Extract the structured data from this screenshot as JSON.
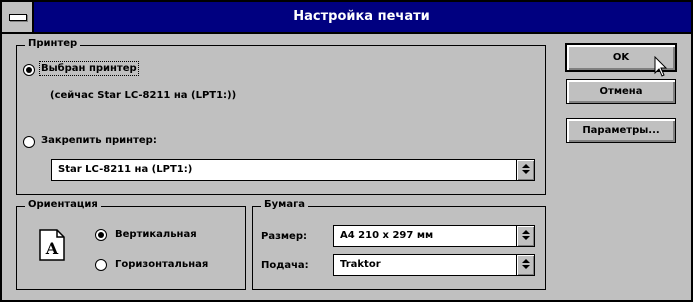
{
  "window": {
    "title": "Настройка печати"
  },
  "printer_group": {
    "legend": "Принтер",
    "default_option": {
      "label": "Выбран принтер",
      "checked": true
    },
    "current_printer": "(сейчас Star LC-8211 на  (LPT1:))",
    "specific_option": {
      "label": "Закрепить принтер:",
      "checked": false
    },
    "specific_select": {
      "value": "Star LC-8211 на  (LPT1:)"
    }
  },
  "orientation_group": {
    "legend": "Ориентация",
    "icon_letter": "A",
    "portrait": {
      "label": "Вертикальная",
      "checked": true
    },
    "landscape": {
      "label": "Горизонтальная",
      "checked": false
    }
  },
  "paper_group": {
    "legend": "Бумага",
    "size_label": "Размер:",
    "size_value": "А4 210 x 297 мм",
    "source_label": "Подача:",
    "source_value": "Traktor"
  },
  "buttons": {
    "ok": "OK",
    "cancel": "Отмена",
    "options": "Параметры..."
  }
}
